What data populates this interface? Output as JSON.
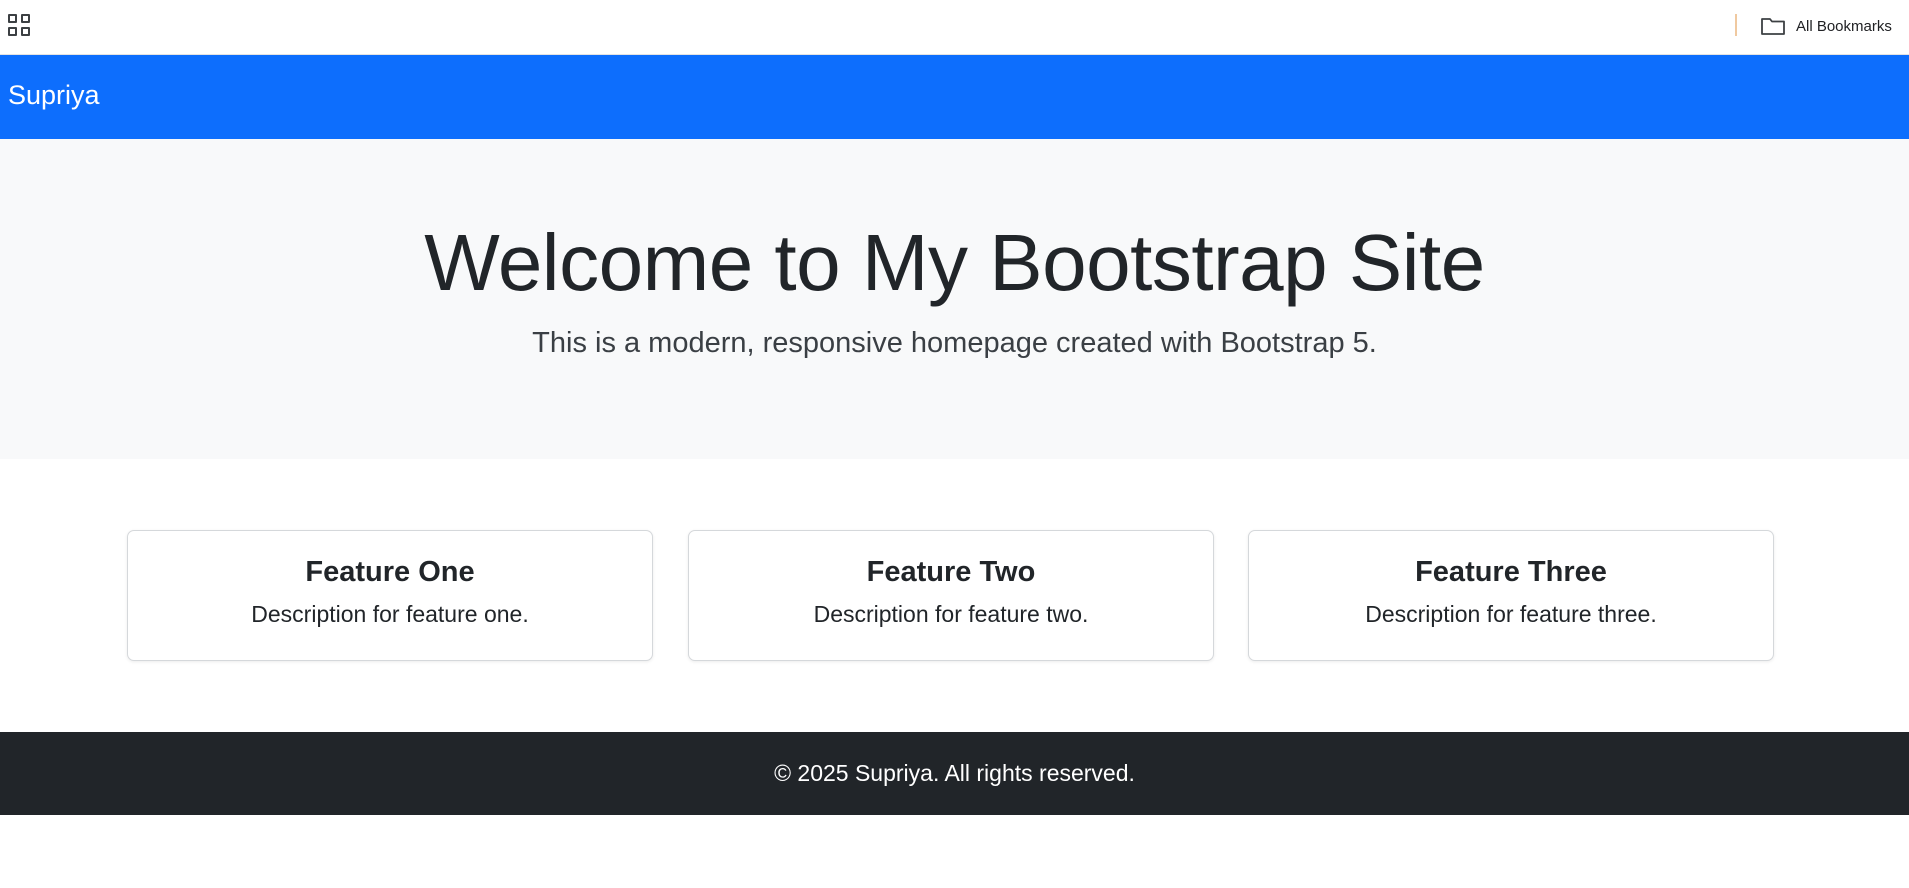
{
  "bookmarks_bar": {
    "apps_icon": "apps-grid-icon",
    "all_bookmarks_label": "All Bookmarks",
    "folder_icon": "folder-icon"
  },
  "navbar": {
    "brand": "Supriya",
    "background_color": "#0d6efd"
  },
  "hero": {
    "title": "Welcome to My Bootstrap Site",
    "subtitle": "This is a modern, responsive homepage created with Bootstrap 5."
  },
  "features": [
    {
      "title": "Feature One",
      "description": "Description for feature one."
    },
    {
      "title": "Feature Two",
      "description": "Description for feature two."
    },
    {
      "title": "Feature Three",
      "description": "Description for feature three."
    }
  ],
  "footer": {
    "text": "© 2025 Supriya. All rights reserved.",
    "background_color": "#212529"
  }
}
